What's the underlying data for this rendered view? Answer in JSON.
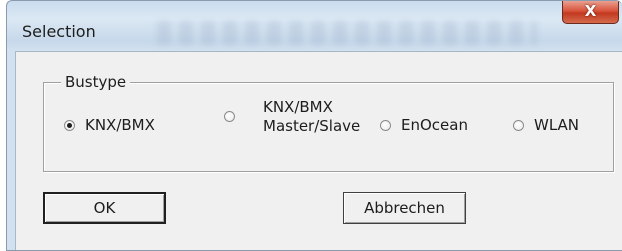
{
  "window": {
    "title": "Selection",
    "close_glyph": "X"
  },
  "bustype": {
    "legend": "Bustype",
    "options": [
      {
        "label_line1": "KNX/BMX",
        "label_line2": "",
        "checked": true
      },
      {
        "label_line1": "KNX/BMX",
        "label_line2": "Master/Slave",
        "checked": false
      },
      {
        "label_line1": "EnOcean",
        "label_line2": "",
        "checked": false
      },
      {
        "label_line1": "WLAN",
        "label_line2": "",
        "checked": false
      }
    ],
    "selected": "KNX/BMX"
  },
  "buttons": {
    "ok_label": "OK",
    "cancel_label": "Abbrechen"
  },
  "icons": {
    "close": "close-icon",
    "radio_checked": "radio-checked-icon",
    "radio_unchecked": "radio-unchecked-icon"
  },
  "colors": {
    "close_button": "#d9543c",
    "dialog_face": "#f0f0f0",
    "titlebar": "#d2e1ef"
  }
}
